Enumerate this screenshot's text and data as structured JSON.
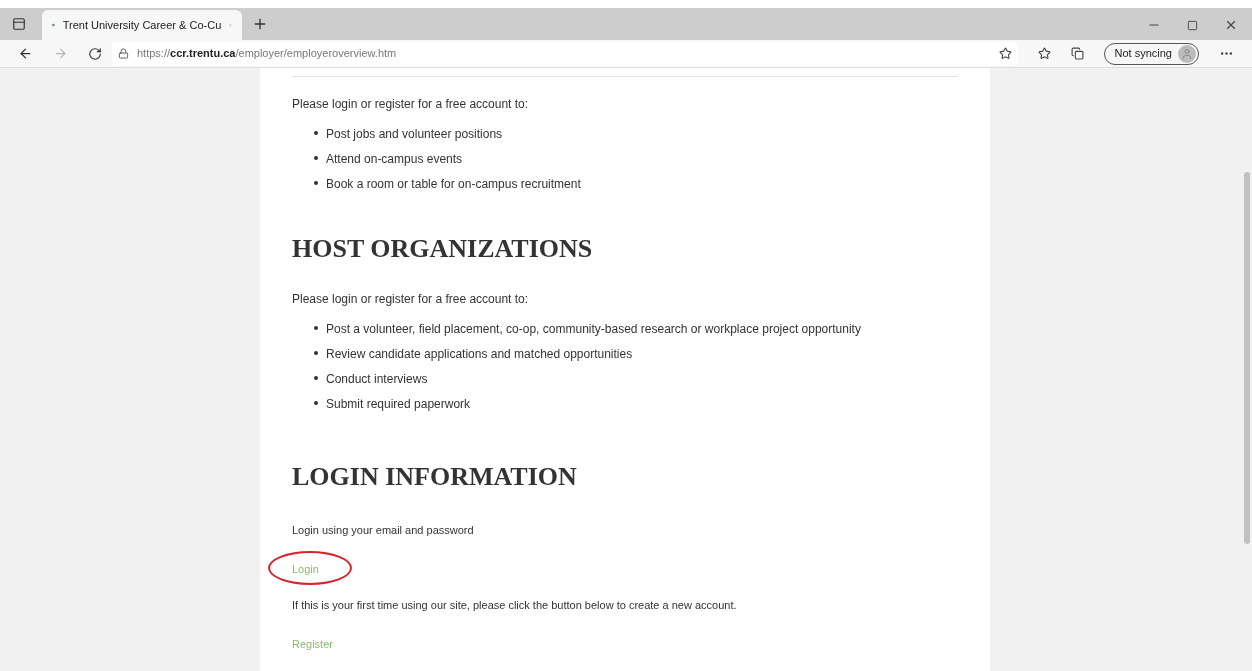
{
  "browser": {
    "tab": {
      "title": "Trent University Career & Co-Cu",
      "selected": true
    },
    "url": "https://**ccr.trentu.ca**/employer/employeroverview.htm",
    "profile": {
      "label": "Not syncing"
    }
  },
  "sections": [
    {
      "intro": "Please login or register for a free account to:",
      "items": [
        "Post jobs and volunteer positions",
        "Attend on-campus events",
        "Book a room or table for on-campus recruitment"
      ]
    },
    {
      "heading": "HOST ORGANIZATIONS",
      "intro": "Please login or register for a free account to:",
      "items": [
        "Post a volunteer, field placement, co-op, community-based research or workplace project opportunity",
        "Review candidate applications and matched opportunities",
        "Conduct interviews",
        "Submit required paperwork"
      ]
    }
  ],
  "login": {
    "heading": "LOGIN INFORMATION",
    "text": "Login using your email and password",
    "login_link": {
      "label": "Login",
      "circled": true
    },
    "register_text": "If this is your first time using our site, please click the button below to create a new account.",
    "register_link": "Register"
  }
}
